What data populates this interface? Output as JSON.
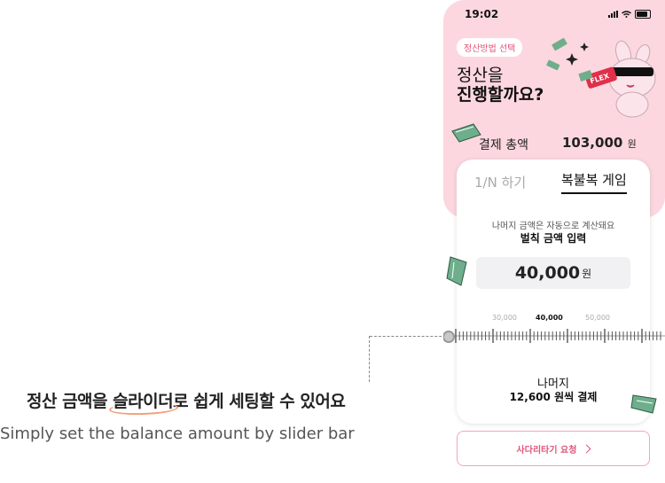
{
  "caption": {
    "korean_before": "정산 금액을 ",
    "korean_highlight": "슬라이더",
    "korean_after": "로 쉽게 세팅할 수 있어요",
    "english": "Simply set the balance amount by slider bar"
  },
  "status_bar": {
    "time": "19:02"
  },
  "header": {
    "badge": "정산방법 선택",
    "title_line1": "정산을",
    "title_line2": "진행할까요?",
    "sign_text": "FLEX"
  },
  "total": {
    "label": "결제 총액",
    "value": "103,000",
    "unit": "원"
  },
  "tabs": [
    {
      "label": "1/N 하기",
      "active": false
    },
    {
      "label": "복불복 게임",
      "active": true
    }
  ],
  "penalty": {
    "hint": "나머지 금액은 자동으로 계산돼요",
    "label": "벌칙 금액 입력",
    "amount": "40,000",
    "unit": "원"
  },
  "slider": {
    "labels": [
      "30,000",
      "40,000",
      "50,000"
    ],
    "current": "40,000"
  },
  "remainder": {
    "line1": "나머지",
    "line2": "12,600 원씩 결제"
  },
  "ladder_button": {
    "label": "사다리타기 요청"
  },
  "colors": {
    "accent": "#e0557a",
    "pink_bg": "#fcd7df",
    "money_green": "#6fae8c"
  }
}
